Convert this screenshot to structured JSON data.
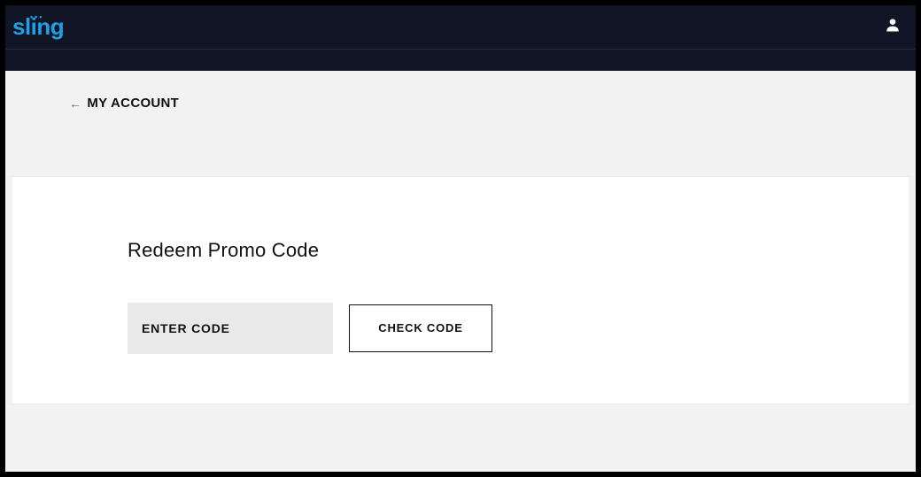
{
  "header": {
    "brand": "sling"
  },
  "page": {
    "back_label": "MY ACCOUNT",
    "section_title": "Redeem Promo Code",
    "code_placeholder": "ENTER CODE",
    "code_value": "",
    "check_button": "CHECK CODE"
  }
}
